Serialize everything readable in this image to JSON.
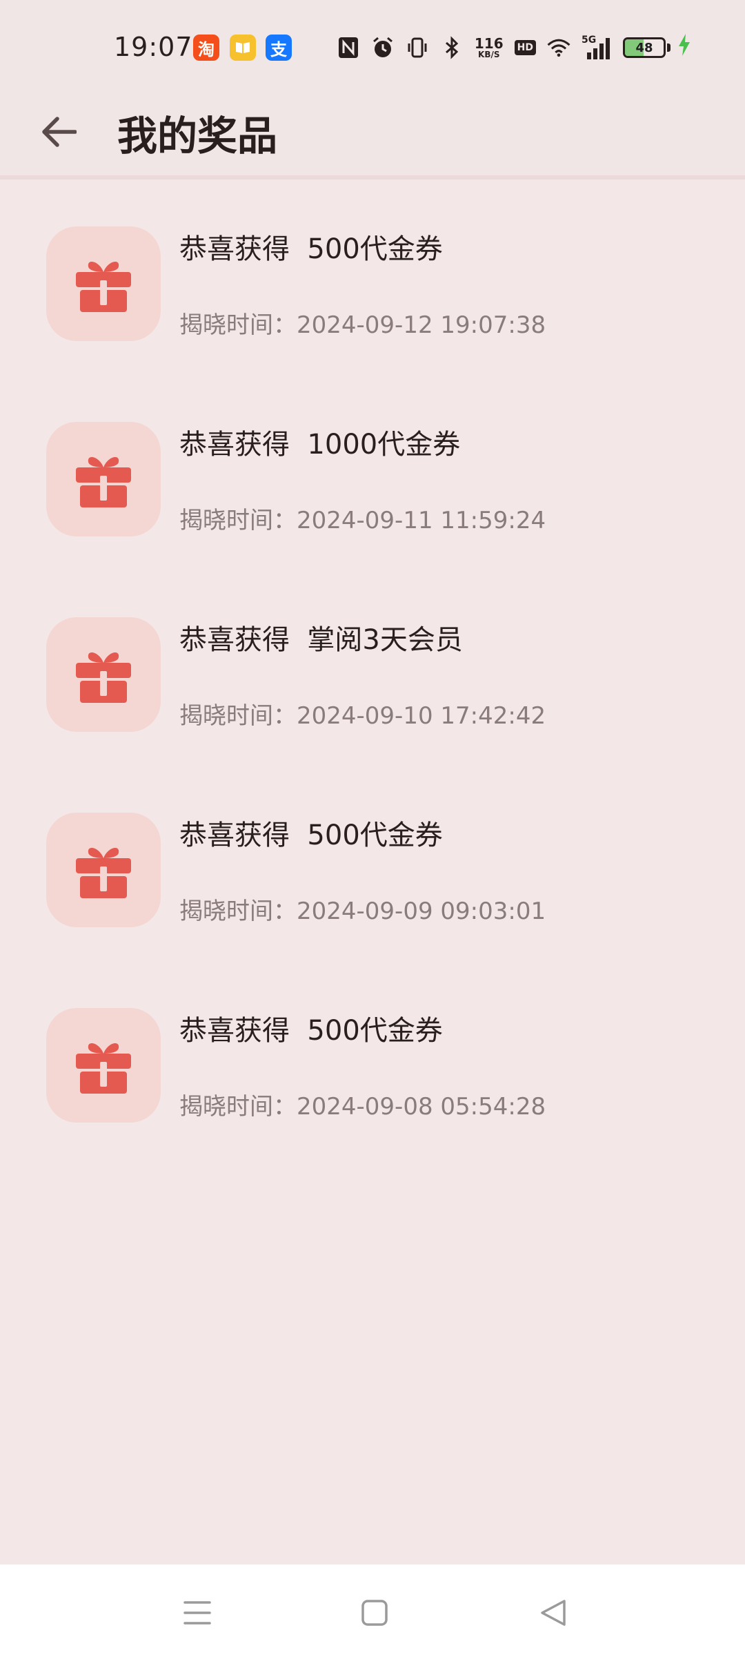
{
  "status_bar": {
    "time": "19:07",
    "app_icons": [
      {
        "name": "taobao-icon",
        "glyph": "淘"
      },
      {
        "name": "reader-app-icon",
        "glyph": ""
      },
      {
        "name": "alipay-icon",
        "glyph": "支"
      }
    ],
    "net_speed_value": "116",
    "net_speed_unit": "KB/S",
    "hd_label": "HD",
    "network_type": "5G",
    "battery_level": "48",
    "battery_percent": 48
  },
  "header": {
    "title": "我的奖品"
  },
  "colors": {
    "background": "#f3e7e7",
    "tile": "#f4d7d3",
    "gift": "#e45a50",
    "secondary_text": "#8a7c7c"
  },
  "prizes": [
    {
      "title": "恭喜获得  500代金券",
      "time": "揭晓时间：2024-09-12 19:07:38"
    },
    {
      "title": "恭喜获得  1000代金券",
      "time": "揭晓时间：2024-09-11 11:59:24"
    },
    {
      "title": "恭喜获得  掌阅3天会员",
      "time": "揭晓时间：2024-09-10 17:42:42"
    },
    {
      "title": "恭喜获得  500代金券",
      "time": "揭晓时间：2024-09-09 09:03:01"
    },
    {
      "title": "恭喜获得  500代金券",
      "time": "揭晓时间：2024-09-08 05:54:28"
    }
  ]
}
